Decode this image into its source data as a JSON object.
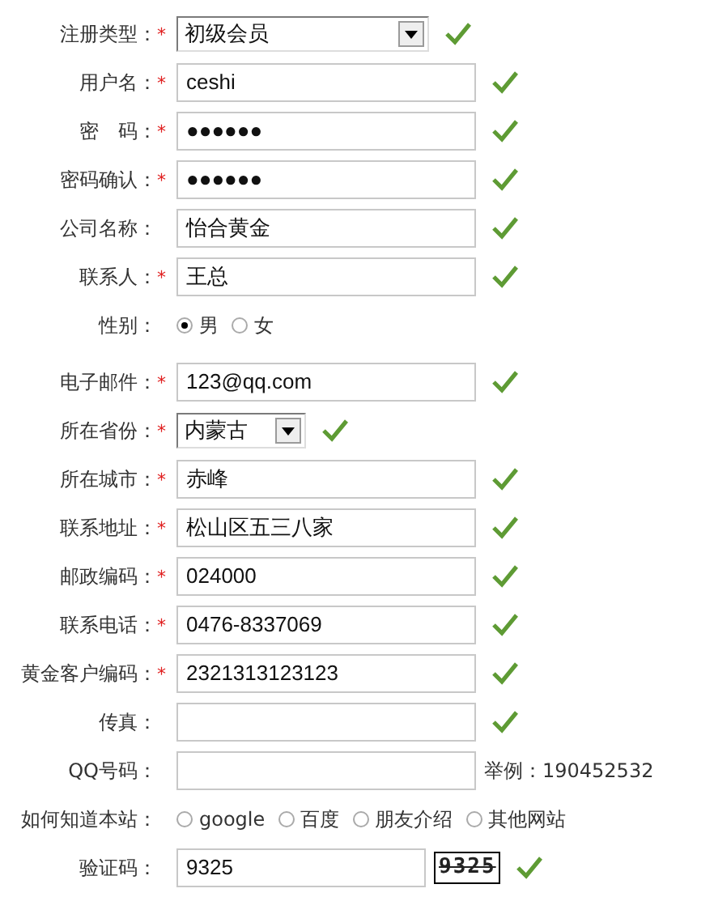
{
  "rows": [
    {
      "kind": "select",
      "label": "注册类型：",
      "mark": "*",
      "value": "初级会员",
      "valid": true
    },
    {
      "kind": "text",
      "label": "用户名：",
      "mark": "*",
      "value": "ceshi",
      "valid": true
    },
    {
      "kind": "text",
      "label": "密　码：",
      "mark": "*",
      "value": "●●●●●●",
      "valid": true
    },
    {
      "kind": "text",
      "label": "密码确认：",
      "mark": "*",
      "value": "●●●●●●",
      "valid": true
    },
    {
      "kind": "text",
      "label": "公司名称：",
      "value": "怡合黄金",
      "valid": true
    },
    {
      "kind": "text",
      "label": "联系人：",
      "mark": "*",
      "value": "王总",
      "valid": true
    },
    {
      "kind": "radio",
      "label": "性别：",
      "options": [
        {
          "label": "男",
          "selected": true
        },
        {
          "label": "女",
          "selected": false
        }
      ]
    },
    {
      "kind": "text",
      "label": "电子邮件：",
      "mark": "*",
      "value": "123@qq.com",
      "valid": true
    },
    {
      "kind": "small-select",
      "label": "所在省份：",
      "mark": "*",
      "value": "内蒙古",
      "valid": true
    },
    {
      "kind": "text",
      "label": "所在城市：",
      "mark": "*",
      "value": "赤峰",
      "valid": true
    },
    {
      "kind": "text",
      "label": "联系地址：",
      "mark": "*",
      "value": "松山区五三八家",
      "valid": true
    },
    {
      "kind": "text",
      "label": "邮政编码：",
      "mark": "*",
      "value": "024000",
      "valid": true
    },
    {
      "kind": "text",
      "label": "联系电话：",
      "mark": "*",
      "value": "0476-8337069",
      "valid": true
    },
    {
      "kind": "text",
      "label": "黄金客户编码：",
      "mark": "*",
      "value": "2321313123123",
      "valid": true
    },
    {
      "kind": "text",
      "label": "传真：",
      "valid": true
    },
    {
      "kind": "text",
      "label": "QQ号码：",
      "hint": "举例：190452532"
    },
    {
      "kind": "radio",
      "label": "如何知道本站：",
      "options": [
        {
          "label": "google",
          "selected": false
        },
        {
          "label": "百度",
          "selected": false
        },
        {
          "label": "朋友介绍",
          "selected": false
        },
        {
          "label": "其他网站",
          "selected": false
        }
      ]
    },
    {
      "kind": "captcha",
      "label": "验证码：",
      "value": "9325",
      "captcha": "9325",
      "valid": true
    }
  ]
}
